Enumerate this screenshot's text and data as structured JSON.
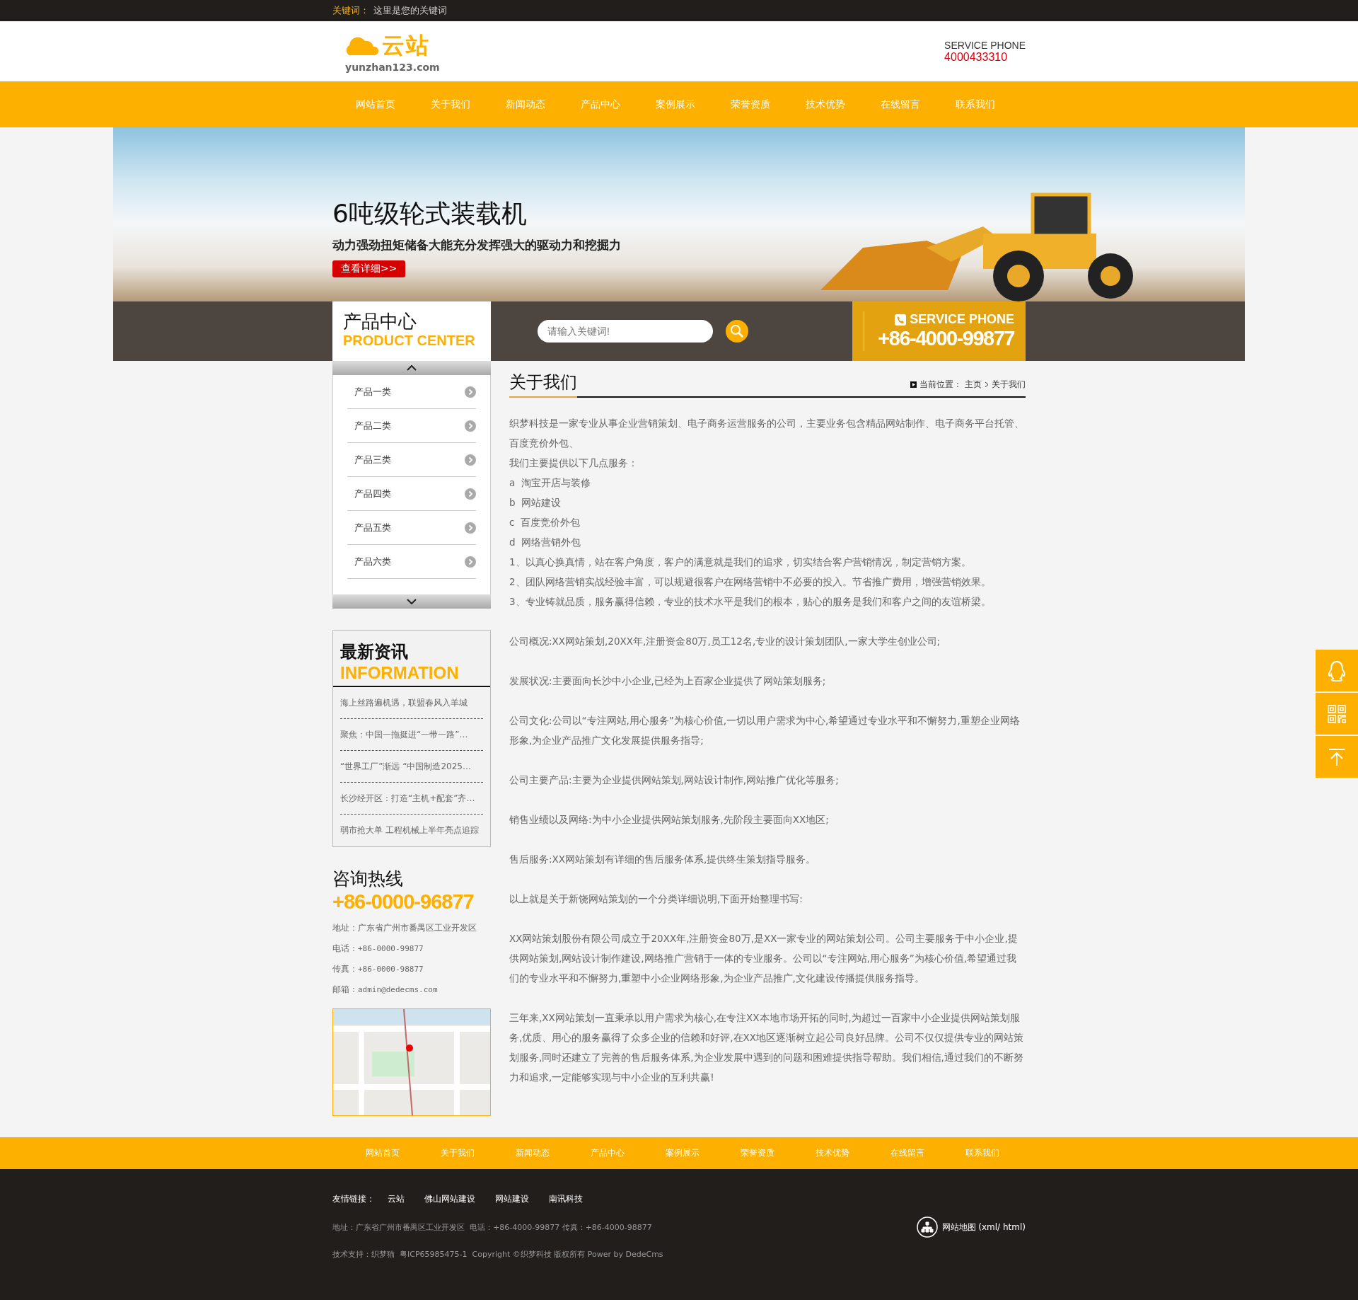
{
  "top_bar": {
    "label": "关键词：",
    "text": "这里是您的关键词"
  },
  "header": {
    "logo_text": "云站",
    "logo_domain": "yunzhan123.com",
    "service_label": "SERVICE PHONE",
    "service_phone": "4000433310"
  },
  "nav": [
    "网站首页",
    "关于我们",
    "新闻动态",
    "产品中心",
    "案例展示",
    "荣誉资质",
    "技术优势",
    "在线留言",
    "联系我们"
  ],
  "banner": {
    "title": "6吨级轮式装载机",
    "subtitle": "动力强劲扭矩储备大能充分发挥强大的驱动力和挖掘力",
    "button": "查看详细>>"
  },
  "strip": {
    "section_title": "产品中心",
    "section_title_en": "PRODUCT CENTER",
    "search_placeholder": "请输入关键词!",
    "phone_label": "SERVICE PHONE",
    "phone": "+86-4000-99877"
  },
  "product_categories": [
    "产品一类",
    "产品二类",
    "产品三类",
    "产品四类",
    "产品五类",
    "产品六类"
  ],
  "news": {
    "title": "最新资讯",
    "title_en": "INFORMATION",
    "items": [
      "海上丝路遍机遇，联盟春风入羊城",
      "聚焦：中国一拖挺进“一带一路”…",
      "“世界工厂”渐远 “中国制造2025…",
      "长沙经开区：打造“主机+配套”齐…",
      "弱市抢大单 工程机械上半年亮点追踪"
    ]
  },
  "contact": {
    "title": "咨询热线",
    "phone": "+86-0000-96877",
    "lines": [
      {
        "label": "地址：",
        "value": "广东省广州市番禺区工业开发区",
        "kind": "text"
      },
      {
        "label": "电话：",
        "value": "+86-0000-99877",
        "kind": "mono"
      },
      {
        "label": "传真：",
        "value": "+86-0000-98877",
        "kind": "mono"
      },
      {
        "label": "邮箱：",
        "value": "admin@dedecms.com",
        "kind": "mono"
      }
    ]
  },
  "article": {
    "title": "关于我们",
    "breadcrumb": {
      "label": "当前位置：",
      "items": [
        "主页",
        "关于我们"
      ]
    },
    "groups": [
      {
        "lines": [
          "织梦科技是一家专业从事企业营销策划、电子商务运营服务的公司，主要业务包含精品网站制作、电子商务平台托管、百度竞价外包、",
          "我们主要提供以下几点服务：",
          "a  淘宝开店与装修",
          "b  网站建设",
          "c  百度竞价外包",
          "d  网络营销外包",
          "1、以真心换真情，站在客户角度，客户的满意就是我们的追求，切实结合客户营销情况，制定营销方案。",
          "2、团队网络营销实战经验丰富，可以规避很客户在网络营销中不必要的投入。节省推广费用，增强营销效果。",
          "3、专业铸就品质，服务赢得信赖，专业的技术水平是我们的根本，贴心的服务是我们和客户之间的友谊桥梁。"
        ]
      },
      {
        "lines": [
          "公司概况:XX网站策划,20XX年,注册资金80万,员工12名,专业的设计策划团队,一家大学生创业公司;"
        ]
      },
      {
        "lines": [
          "发展状况:主要面向长沙中小企业,已经为上百家企业提供了网站策划服务;"
        ]
      },
      {
        "lines": [
          "公司文化:公司以“专注网站,用心服务”为核心价值,一切以用户需求为中心,希望通过专业水平和不懈努力,重塑企业网络形象,为企业产品推广文化发展提供服务指导;"
        ]
      },
      {
        "lines": [
          "公司主要产品:主要为企业提供网站策划,网站设计制作,网站推广优化等服务;"
        ]
      },
      {
        "lines": [
          "销售业绩以及网络:为中小企业提供网站策划服务,先阶段主要面向XX地区;"
        ]
      },
      {
        "lines": [
          "售后服务:XX网站策划有详细的售后服务体系,提供终生策划指导服务。"
        ]
      },
      {
        "lines": [
          "以上就是关于新饶网站策划的一个分类详细说明,下面开始整理书写:"
        ]
      },
      {
        "lines": [
          "XX网站策划股份有限公司成立于20XX年,注册资金80万,是XX一家专业的网站策划公司。公司主要服务于中小企业,提供网站策划,网站设计制作建设,网络推广营销于一体的专业服务。公司以“专注网站,用心服务”为核心价值,希望通过我们的专业水平和不懈努力,重塑中小企业网络形象,为企业产品推广,文化建设传播提供服务指导。"
        ]
      },
      {
        "lines": [
          "三年来,XX网站策划一直秉承以用户需求为核心,在专注XX本地市场开拓的同时,为超过一百家中小企业提供网站策划服务,优质、用心的服务赢得了众多企业的信赖和好评,在XX地区逐渐树立起公司良好品牌。公司不仅仅提供专业的网站策划服务,同时还建立了完善的售后服务体系,为企业发展中遇到的问题和困难提供指导帮助。我们相信,通过我们的不断努力和追求,一定能够实现与中小企业的互利共赢!"
        ]
      }
    ]
  },
  "footer_nav": [
    "网站首页",
    "关于我们",
    "新闻动态",
    "产品中心",
    "案例展示",
    "荣誉资质",
    "技术优势",
    "在线留言",
    "联系我们"
  ],
  "footer": {
    "links_label": "友情链接：",
    "links": [
      "云站",
      "佛山网站建设",
      "网站建设",
      "南讯科技"
    ],
    "address": "地址：广东省广州市番禺区工业开发区  电话：+86-4000-99877 传真：+86-4000-98877",
    "sitemap": "网站地图 (xml/ html)",
    "copyright": "技术支持：织梦猫  粤ICP65985475-1  Copyright ©织梦科技 版权所有 Power by DedeCms"
  }
}
